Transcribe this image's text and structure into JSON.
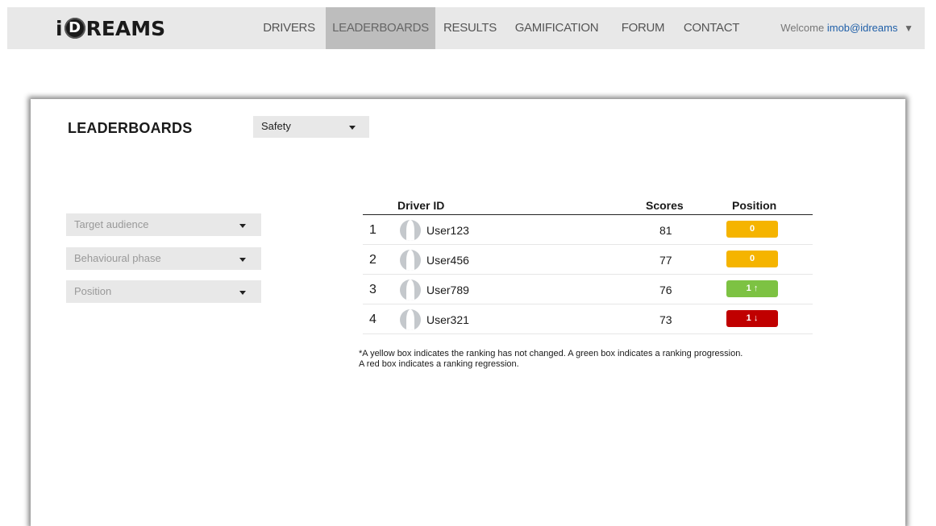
{
  "header": {
    "logo_prefix": "i",
    "logo_disc": "D",
    "logo_suffix": "REAMS",
    "nav": [
      "DRIVERS",
      "LEADERBOARDS",
      "RESULTS",
      "GAMIFICATION",
      "FORUM",
      "CONTACT"
    ],
    "active_nav": "LEADERBOARDS",
    "welcome_label": "Welcome",
    "user": "imob@idreams",
    "caret": "▼"
  },
  "page": {
    "title": "LEADERBOARDS",
    "metric_select": "Safety"
  },
  "filters": [
    {
      "label": "Target audience"
    },
    {
      "label": "Behavioural phase"
    },
    {
      "label": "Position"
    }
  ],
  "table": {
    "headers": {
      "driver": "Driver ID",
      "scores": "Scores",
      "position": "Position"
    },
    "rows": [
      {
        "rank": "1",
        "user": "User123",
        "score": "81",
        "position": "0",
        "status": "unchanged"
      },
      {
        "rank": "2",
        "user": "User456",
        "score": "77",
        "position": "0",
        "status": "unchanged"
      },
      {
        "rank": "3",
        "user": "User789",
        "score": "76",
        "position": "1 ↑",
        "status": "progression"
      },
      {
        "rank": "4",
        "user": "User321",
        "score": "73",
        "position": "1 ↓",
        "status": "regression"
      }
    ]
  },
  "colors": {
    "unchanged": "#f5b400",
    "progression": "#7dc243",
    "regression": "#c00000"
  },
  "note_line1": "*A yellow box indicates the ranking has not changed. A green box indicates a ranking progression.",
  "note_line2": "A red box indicates a ranking regression."
}
